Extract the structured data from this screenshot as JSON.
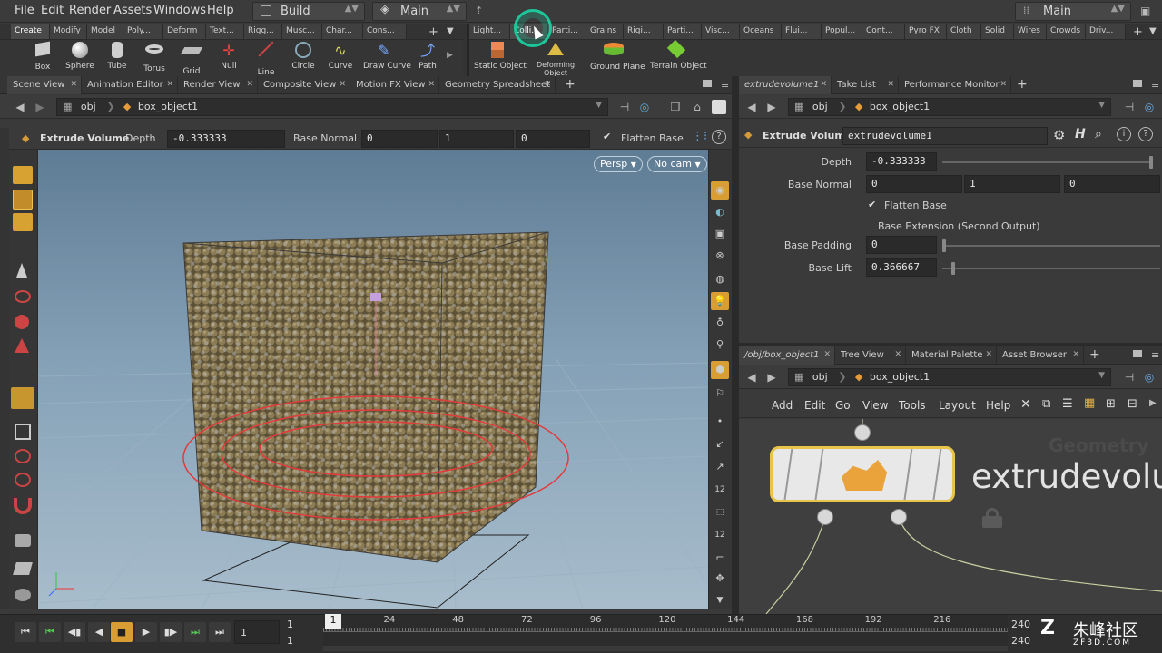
{
  "menubar": {
    "items": [
      "File",
      "Edit",
      "Render",
      "Assets",
      "Windows",
      "Help"
    ],
    "desktop_left": "Build",
    "desktop_mid": "Main",
    "desktop_right": "Main"
  },
  "shelf_tabs_left": [
    "Create",
    "Modify",
    "Model",
    "Poly...",
    "Deform",
    "Text...",
    "Rigg...",
    "Musc...",
    "Char...",
    "Cons..."
  ],
  "shelf_tabs_right": [
    "Light...",
    "Colli...",
    "Parti...",
    "Grains",
    "Rigi...",
    "Parti...",
    "Visc...",
    "Oceans",
    "Flui...",
    "Popul...",
    "Cont...",
    "Pyro FX",
    "Cloth",
    "Solid",
    "Wires",
    "Crowds",
    "Driv..."
  ],
  "tools_left": [
    {
      "label": "Box",
      "icon": "box-icon"
    },
    {
      "label": "Sphere",
      "icon": "sphere-icon"
    },
    {
      "label": "Tube",
      "icon": "tube-icon"
    },
    {
      "label": "Torus",
      "icon": "torus-icon"
    },
    {
      "label": "Grid",
      "icon": "grid-icon"
    },
    {
      "label": "Null",
      "icon": "null-icon"
    },
    {
      "label": "Line",
      "icon": "line-icon"
    },
    {
      "label": "Circle",
      "icon": "circle-icon"
    },
    {
      "label": "Curve",
      "icon": "curve-icon"
    },
    {
      "label": "Draw Curve",
      "icon": "draw-curve-icon"
    },
    {
      "label": "Path",
      "icon": "path-icon"
    }
  ],
  "tools_right": [
    {
      "label": "Static Object",
      "icon": "static-object-icon"
    },
    {
      "label": "Deforming Object",
      "icon": "deforming-object-icon"
    },
    {
      "label": "Ground Plane",
      "icon": "ground-plane-icon"
    },
    {
      "label": "Terrain Object",
      "icon": "terrain-object-icon"
    }
  ],
  "viewer_tabs": [
    "Scene View",
    "Animation Editor",
    "Render View",
    "Composite View",
    "Motion FX View",
    "Geometry Spreadsheet"
  ],
  "viewer_path": {
    "root": "obj",
    "node": "box_object1"
  },
  "op_toolbar": {
    "op_name": "Extrude Volume",
    "depth_label": "Depth",
    "depth_value": "-0.333333",
    "base_normal_label": "Base Normal",
    "bn_x": "0",
    "bn_y": "1",
    "bn_z": "0",
    "flatten_label": "Flatten Base"
  },
  "viewport": {
    "persp": "Persp",
    "cam": "No cam"
  },
  "param_tabs": [
    "extrudevolume1",
    "Take List",
    "Performance Monitor"
  ],
  "param_path": {
    "root": "obj",
    "node": "box_object1"
  },
  "params": {
    "op_type": "Extrude Volume",
    "node_name": "extrudevolume1",
    "depth_label": "Depth",
    "depth_value": "-0.333333",
    "depth_fraction": 0.99,
    "base_normal_label": "Base Normal",
    "bn_x": "0",
    "bn_y": "1",
    "bn_z": "0",
    "flatten_label": "Flatten Base",
    "base_ext_label": "Base Extension (Second Output)",
    "padding_label": "Base Padding",
    "padding_value": "0",
    "padding_fraction": 0.0,
    "lift_label": "Base Lift",
    "lift_value": "0.366667",
    "lift_fraction": 0.04
  },
  "net_tabs": [
    "/obj/box_object1",
    "Tree View",
    "Material Palette",
    "Asset Browser"
  ],
  "net_path": {
    "root": "obj",
    "node": "box_object1"
  },
  "net_menu": [
    "Add",
    "Edit",
    "Go",
    "View",
    "Tools",
    "Layout",
    "Help"
  ],
  "network": {
    "context": "Geometry",
    "node_label": "extrudevolu"
  },
  "timeline": {
    "start_frame": "1",
    "end_frame": "240",
    "current": "1",
    "frame_field": "1",
    "range_start": "1",
    "ticks": [
      "24",
      "48",
      "72",
      "96",
      "120",
      "144",
      "168",
      "192",
      "216"
    ],
    "end_label": "240",
    "end_label2": "240",
    "start_label2": "1"
  },
  "watermark": {
    "site": "ZF3D.COM",
    "name": "朱峰社区"
  },
  "colors": {
    "accent_node": "#e8c44a",
    "selection": "#e45050",
    "teal_cursor": "#1cc89a"
  }
}
